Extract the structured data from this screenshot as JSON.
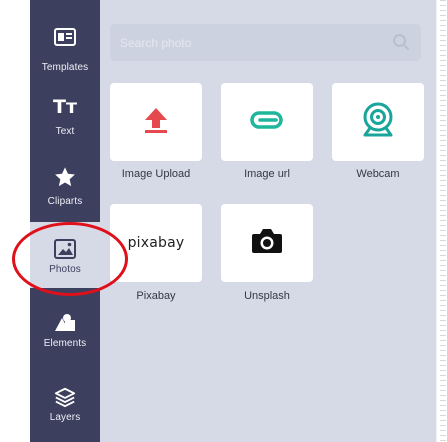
{
  "sidebar": {
    "items": [
      {
        "label": "Templates",
        "icon": "templates-icon"
      },
      {
        "label": "Text",
        "icon": "text-icon"
      },
      {
        "label": "Cliparts",
        "icon": "star-icon"
      },
      {
        "label": "Photos",
        "icon": "photos-icon"
      },
      {
        "label": "Elements",
        "icon": "elements-icon"
      },
      {
        "label": "Layers",
        "icon": "layers-icon"
      }
    ],
    "active": "Photos",
    "text_icon_glyph": "Tт"
  },
  "search": {
    "placeholder": "Search photo"
  },
  "sources": [
    {
      "label": "Image Upload",
      "icon": "upload-arrow-icon"
    },
    {
      "label": "Image url",
      "icon": "link-icon"
    },
    {
      "label": "Webcam",
      "icon": "webcam-icon"
    },
    {
      "label": "Pixabay",
      "icon": "pixabay-logo",
      "logo_text": "pixabay"
    },
    {
      "label": "Unsplash",
      "icon": "camera-icon"
    }
  ],
  "colors": {
    "sidebar_bg": "#3d3f5e",
    "panel_bg": "#d6dae6",
    "upload_red": "#e5484d",
    "link_teal": "#1fb79b",
    "webcam_teal": "#1aa59b",
    "highlight_red": "#e0101b"
  }
}
